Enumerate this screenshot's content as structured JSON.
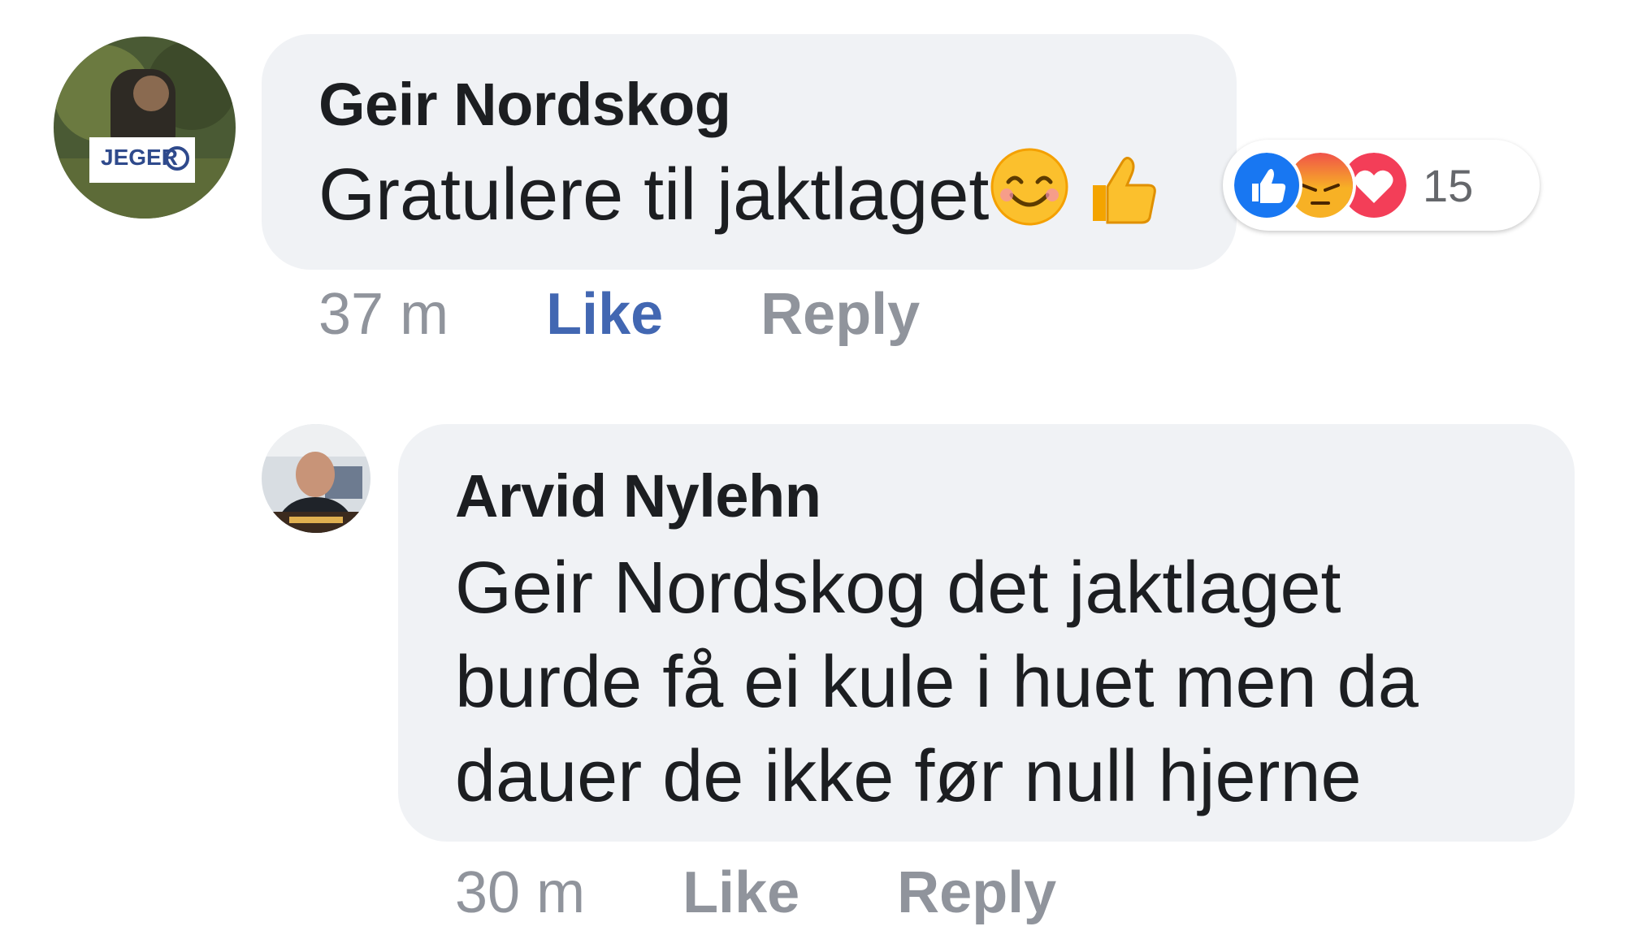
{
  "comments": [
    {
      "author": "Geir Nordskog",
      "text": "Gratulere til jaktlaget",
      "time": "37 m",
      "like_label": "Like",
      "reply_label": "Reply",
      "reactions": {
        "icons": [
          "like-icon",
          "angry-icon",
          "love-icon"
        ],
        "count": "15"
      },
      "text_emojis": [
        "smiling-face-icon",
        "thumbs-up-icon"
      ],
      "avatar_badge": "JEGER"
    },
    {
      "author": "Arvid Nylehn",
      "text_lines": [
        "Geir Nordskog det jaktlaget",
        "burde få ei kule i huet men da",
        "dauer de ikke før null hjerne"
      ],
      "time": "30 m",
      "like_label": "Like",
      "reply_label": "Reply"
    }
  ],
  "colors": {
    "bubble": "#f0f2f5",
    "text": "#1c1e21",
    "meta": "#90949c",
    "like_active": "#4267b2",
    "like_reaction": "#1877f2",
    "love_reaction": "#f33e58",
    "angry_reaction": "#f7b125"
  }
}
